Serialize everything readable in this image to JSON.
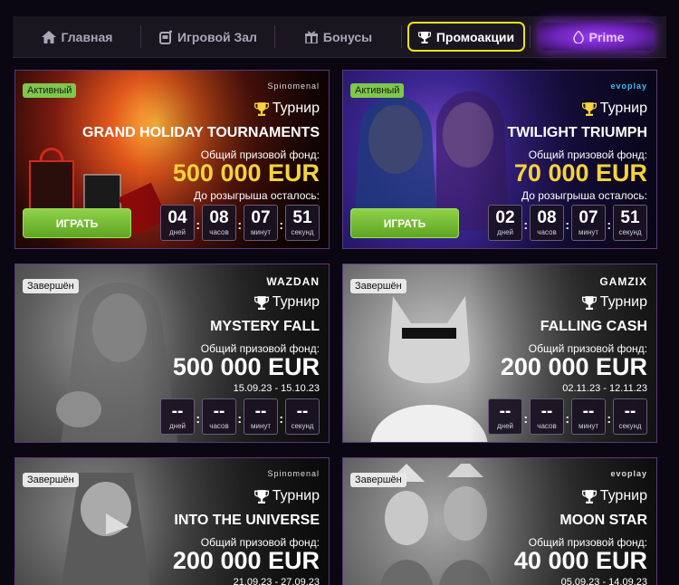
{
  "nav": {
    "items": [
      {
        "label": "Главная",
        "icon": "home-icon"
      },
      {
        "label": "Игровой Зал",
        "icon": "slot-machine-icon"
      },
      {
        "label": "Бонусы",
        "icon": "gift-icon"
      },
      {
        "label": "Промоакции",
        "icon": "trophy-icon",
        "active": true
      },
      {
        "label": "Prime",
        "icon": "diamond-icon"
      }
    ],
    "highlight_color": "#f0e11c"
  },
  "labels": {
    "tournament": "Турнир",
    "fund": "Общий призовой фонд:",
    "until": "До розыгрыша осталось:",
    "play": "ИГРАТЬ",
    "days": "дней",
    "hours": "часов",
    "minutes": "минут",
    "seconds": "секунд"
  },
  "cards": [
    {
      "status": "Активный",
      "brand": "Spinomenal",
      "title": "GRAND HOLIDAY TOURNAMENTS",
      "fund": "500 000 EUR",
      "timer": {
        "d": "04",
        "h": "08",
        "m": "07",
        "s": "51"
      }
    },
    {
      "status": "Активный",
      "brand": "evoplay",
      "title": "TWILIGHT TRIUMPH",
      "fund": "70 000 EUR",
      "timer": {
        "d": "02",
        "h": "08",
        "m": "07",
        "s": "51"
      }
    },
    {
      "status": "Завершён",
      "brand": "WAZDAN",
      "title": "MYSTERY FALL",
      "fund": "500 000 EUR",
      "dates": "15.09.23 - 15.10.23",
      "timer": {
        "d": "--",
        "h": "--",
        "m": "--",
        "s": "--"
      }
    },
    {
      "status": "Завершён",
      "brand": "GAMZIX",
      "title": "FALLING CASH",
      "fund": "200 000 EUR",
      "dates": "02.11.23 - 12.11.23",
      "timer": {
        "d": "--",
        "h": "--",
        "m": "--",
        "s": "--"
      }
    },
    {
      "status": "Завершён",
      "brand": "Spinomenal",
      "title": "INTO THE UNIVERSE",
      "fund": "200 000 EUR",
      "dates": "21.09.23 - 27.09.23"
    },
    {
      "status": "Завершён",
      "brand": "evoplay",
      "title": "MOON STAR",
      "fund": "40 000 EUR",
      "dates": "05.09.23 - 14.09.23"
    }
  ],
  "colors": {
    "active_badge": "#7ec84a",
    "gold": "#f5d33c",
    "play": "#6fb52c"
  }
}
